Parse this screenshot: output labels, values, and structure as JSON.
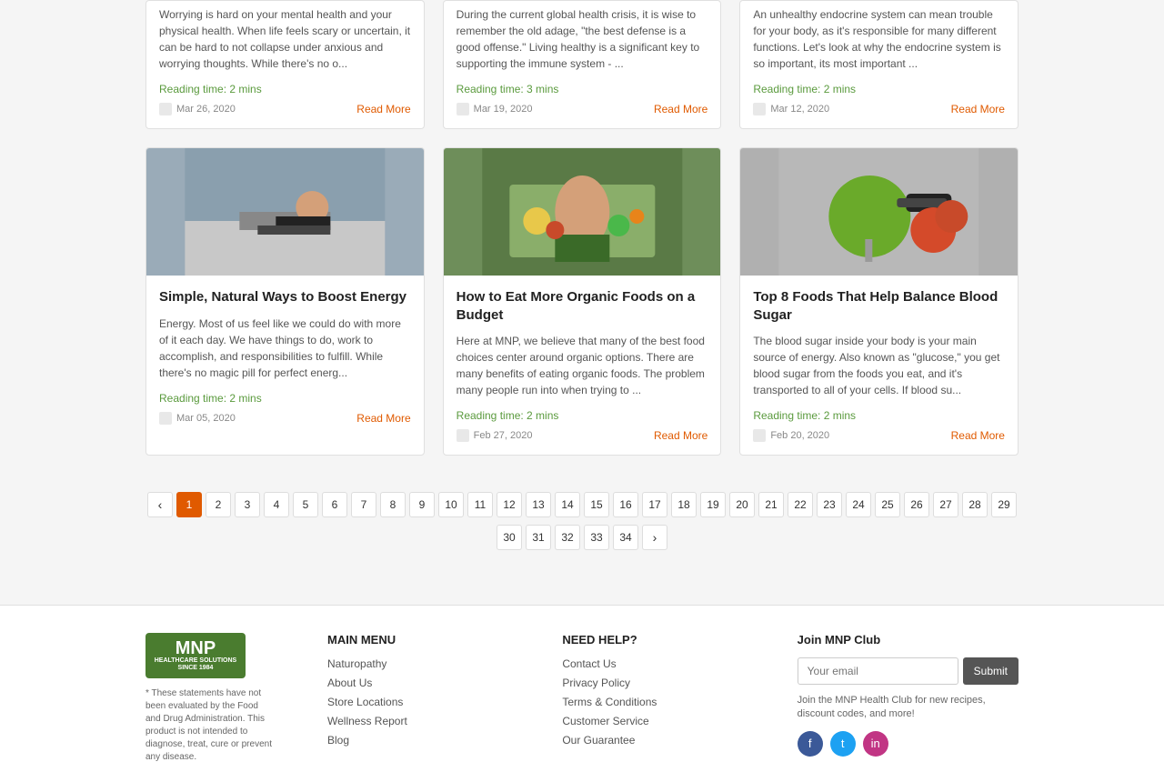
{
  "top_row": [
    {
      "text": "Worrying is hard on your mental health and your physical health. When life feels scary or uncertain, it can be hard to not collapse under anxious and worrying thoughts. While there's no o...",
      "reading_time": "Reading time: 2 mins",
      "date": "Mar 26, 2020",
      "read_more": "Read More"
    },
    {
      "text": "During the current global health crisis, it is wise to remember the old adage, \"the best defense is a good offense.\" Living healthy is a significant key to supporting the immune system - ...",
      "reading_time": "Reading time: 3 mins",
      "date": "Mar 19, 2020",
      "read_more": "Read More"
    },
    {
      "text": "An unhealthy endocrine system can mean trouble for your body, as it's responsible for many different functions. Let's look at why the endocrine system is so important, its most important ...",
      "reading_time": "Reading time: 2 mins",
      "date": "Mar 12, 2020",
      "read_more": "Read More"
    }
  ],
  "main_row": [
    {
      "title": "Simple, Natural Ways to Boost Energy",
      "text": "Energy. Most of us feel like we could do with more of it each day. We have things to do, work to accomplish, and responsibilities to fulfill. While there's no magic pill for perfect energ...",
      "reading_time": "Reading time: 2 mins",
      "date": "Mar 05, 2020",
      "read_more": "Read More",
      "image_bg": "#b0b8c1"
    },
    {
      "title": "How to Eat More Organic Foods on a Budget",
      "text": "Here at MNP, we believe that many of the best food choices center around organic options. There are many benefits of eating organic foods. The problem many people run into when trying to ...",
      "reading_time": "Reading time: 2 mins",
      "date": "Feb 27, 2020",
      "read_more": "Read More",
      "image_bg": "#7a9e6e"
    },
    {
      "title": "Top 8 Foods That Help Balance Blood Sugar",
      "text": "The blood sugar inside your body is your main source of energy. Also known as \"glucose,\" you get blood sugar from the foods you eat, and it's transported to all of your cells. If blood su...",
      "reading_time": "Reading time: 2 mins",
      "date": "Feb 20, 2020",
      "read_more": "Read More",
      "image_bg": "#c0392b"
    }
  ],
  "pagination": {
    "pages_row1": [
      "1",
      "2",
      "3",
      "4",
      "5",
      "6",
      "7",
      "8",
      "9",
      "10",
      "11",
      "12",
      "13",
      "14",
      "15",
      "16",
      "17",
      "18",
      "19",
      "20",
      "21",
      "22",
      "23",
      "24",
      "25",
      "26",
      "27",
      "28",
      "29"
    ],
    "pages_row2": [
      "30",
      "31",
      "32",
      "33",
      "34"
    ],
    "active": "1",
    "prev_label": "‹",
    "next_label": "›"
  },
  "footer": {
    "logo_text": "MNP",
    "logo_subtitle": "HEALTHCARE SOLUTIONS SINCE 1984",
    "disclaimer": "* These statements have not been evaluated by the Food and Drug Administration. This product is not intended to diagnose, treat, cure or prevent any disease.",
    "main_menu_title": "MAIN MENU",
    "main_menu_items": [
      "Naturopathy",
      "About Us",
      "Store Locations",
      "Wellness Report",
      "Blog"
    ],
    "need_help_title": "NEED HELP?",
    "need_help_items": [
      "Contact Us",
      "Privacy Policy",
      "Terms & Conditions",
      "Customer Service",
      "Our Guarantee"
    ],
    "join_title": "Join MNP Club",
    "email_placeholder": "Your email",
    "submit_label": "Submit",
    "join_desc": "Join the MNP Health Club for new recipes, discount codes, and more!"
  }
}
